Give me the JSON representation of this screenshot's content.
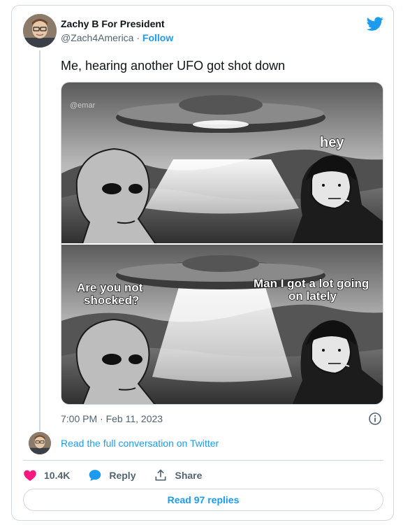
{
  "author": {
    "name": "Zachy B For President",
    "handle": "@Zach4America",
    "separator": " · ",
    "follow_label": "Follow"
  },
  "tweet": {
    "text": "Me, hearing another UFO got shot down",
    "timestamp": "7:00 PM · Feb 11, 2023"
  },
  "meme": {
    "watermark": "@emar",
    "panel1_caption_right": "hey",
    "panel2_caption_left_line1": "Are you not",
    "panel2_caption_left_line2": "shocked?",
    "panel2_caption_right_line1": "Man I got a lot going",
    "panel2_caption_right_line2": "on lately"
  },
  "conversation_link": "Read the full conversation on Twitter",
  "actions": {
    "likes": "10.4K",
    "reply_label": "Reply",
    "share_label": "Share"
  },
  "read_replies_label": "Read 97 replies",
  "colors": {
    "accent": "#1d9bf0",
    "like": "#f91880",
    "muted": "#536471",
    "border": "#cfd9de"
  },
  "icons": [
    "twitter-bird-icon",
    "info-icon",
    "heart-icon",
    "reply-bubble-icon",
    "share-icon"
  ]
}
